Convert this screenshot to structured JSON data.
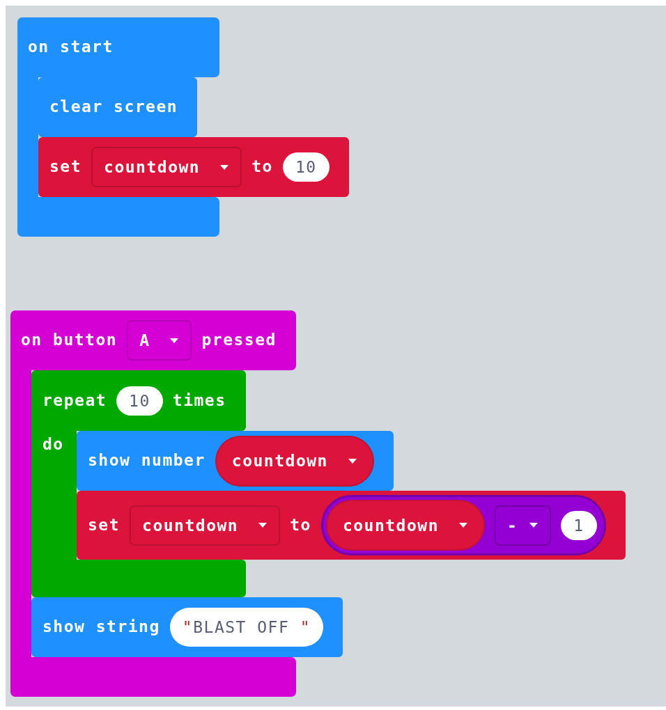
{
  "workspace": {
    "scripts": [
      {
        "kind": "hat",
        "color": "#1e90ff",
        "parts": [
          {
            "kind": "label",
            "text": "on start"
          }
        ],
        "body": [
          {
            "kind": "statement",
            "color": "#1e90ff",
            "parts": [
              {
                "kind": "label",
                "text": "clear screen"
              }
            ]
          },
          {
            "kind": "statement",
            "color": "#dc143c",
            "parts": [
              {
                "kind": "label",
                "text": "set"
              },
              {
                "kind": "dropdown",
                "text": "countdown"
              },
              {
                "kind": "label",
                "text": "to"
              },
              {
                "kind": "number",
                "text": "10"
              }
            ]
          }
        ]
      },
      {
        "kind": "hat",
        "color": "#d400d4",
        "parts": [
          {
            "kind": "label",
            "text": "on button"
          },
          {
            "kind": "dropdown",
            "text": "A"
          },
          {
            "kind": "label",
            "text": "pressed"
          }
        ],
        "body": [
          {
            "kind": "loop",
            "color": "#00a800",
            "parts": [
              {
                "kind": "label",
                "text": "repeat"
              },
              {
                "kind": "number",
                "text": "10"
              },
              {
                "kind": "label",
                "text": "times"
              }
            ],
            "do_label": "do",
            "body": [
              {
                "kind": "statement",
                "color": "#1e90ff",
                "parts": [
                  {
                    "kind": "label",
                    "text": "show number"
                  },
                  {
                    "kind": "variable",
                    "text": "countdown",
                    "color": "#dc143c"
                  }
                ]
              },
              {
                "kind": "statement",
                "color": "#dc143c",
                "parts": [
                  {
                    "kind": "label",
                    "text": "set"
                  },
                  {
                    "kind": "dropdown",
                    "text": "countdown"
                  },
                  {
                    "kind": "label",
                    "text": "to"
                  },
                  {
                    "kind": "operation",
                    "color": "#9400d3",
                    "parts": [
                      {
                        "kind": "variable",
                        "text": "countdown",
                        "color": "#dc143c"
                      },
                      {
                        "kind": "dropdown",
                        "text": "-"
                      },
                      {
                        "kind": "number",
                        "text": "1"
                      }
                    ]
                  }
                ]
              }
            ]
          },
          {
            "kind": "statement",
            "color": "#1e90ff",
            "parts": [
              {
                "kind": "label",
                "text": "show string"
              },
              {
                "kind": "string",
                "open_quote": "\"",
                "text": "BLAST OFF ",
                "close_quote": "\""
              }
            ]
          }
        ]
      }
    ]
  }
}
